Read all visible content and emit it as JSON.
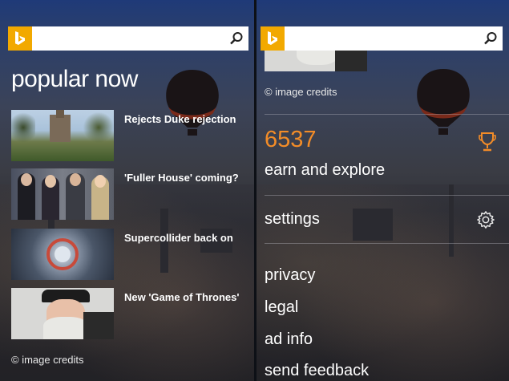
{
  "left": {
    "search": {
      "placeholder": ""
    },
    "heading": "popular now",
    "news": [
      {
        "title": "Rejects Duke rejection"
      },
      {
        "title": "'Fuller House' coming?"
      },
      {
        "title": "Supercollider back on"
      },
      {
        "title": "New 'Game of Thrones'"
      }
    ],
    "credits": "© image credits"
  },
  "right": {
    "search": {
      "placeholder": ""
    },
    "credits": "© image credits",
    "score": "6537",
    "earn_label": "earn and explore",
    "settings_label": "settings",
    "menu": [
      {
        "label": "privacy"
      },
      {
        "label": "legal"
      },
      {
        "label": "ad info"
      },
      {
        "label": "send feedback"
      }
    ]
  },
  "colors": {
    "accent": "#f28c28",
    "bing_logo": "#f2a900"
  },
  "icons": [
    "bing-logo-icon",
    "search-icon",
    "trophy-icon",
    "gear-icon"
  ]
}
